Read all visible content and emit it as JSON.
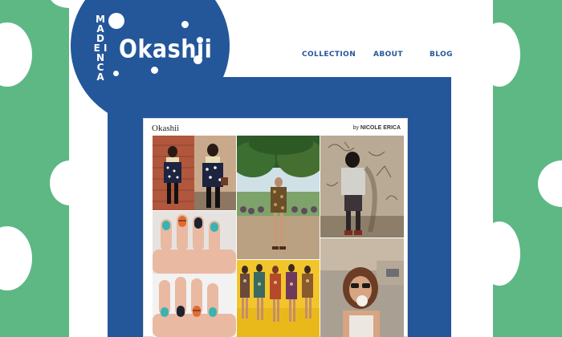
{
  "brand": {
    "name": "Okashii",
    "tagline_vertical": "Made in CA"
  },
  "nav": {
    "collection": "COLLECTION",
    "about": "ABOUT",
    "blog": "BLOG"
  },
  "gallery": {
    "title": "Okashii",
    "by_prefix": "by",
    "author": "NICOLE ERICA",
    "tiles": [
      {
        "name": "polka-dot-outfit-photo"
      },
      {
        "name": "park-festival-photo"
      },
      {
        "name": "graffiti-wall-photo"
      },
      {
        "name": "tribal-nail-art-photo"
      },
      {
        "name": "printed-dresses-photo"
      },
      {
        "name": "bubblegum-girl-photo"
      }
    ]
  },
  "colors": {
    "background_green": "#5db884",
    "brand_blue": "#24579a",
    "white": "#ffffff"
  }
}
